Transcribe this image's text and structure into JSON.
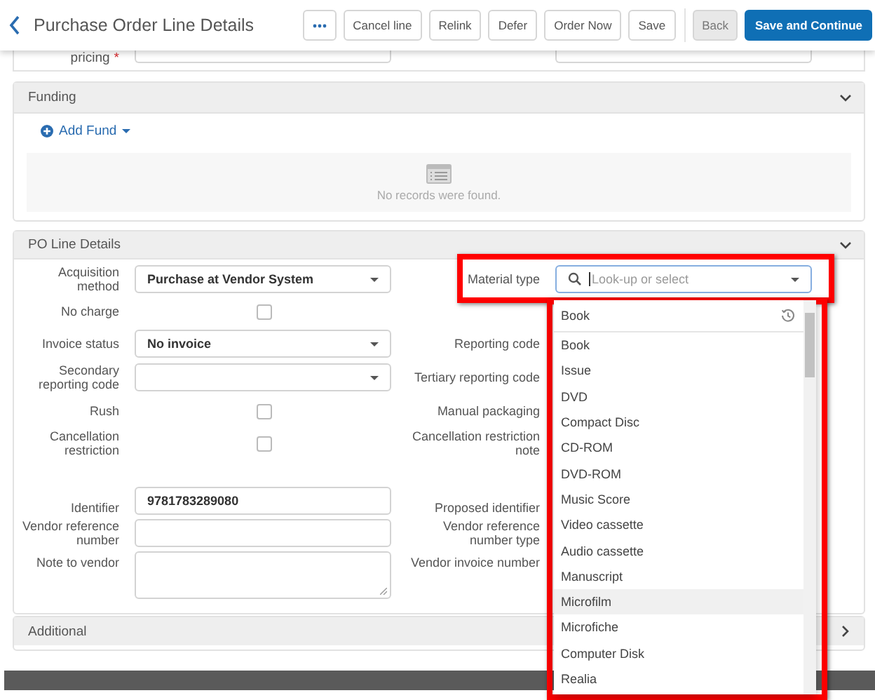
{
  "header": {
    "title": "Purchase Order Line Details",
    "buttons": [
      {
        "kind": "more"
      },
      {
        "kind": "default",
        "label": "Cancel line"
      },
      {
        "kind": "default",
        "label": "Relink"
      },
      {
        "kind": "default",
        "label": "Defer"
      },
      {
        "kind": "default",
        "label": "Order Now"
      },
      {
        "kind": "default",
        "label": "Save"
      },
      {
        "kind": "muted",
        "label": "Back"
      },
      {
        "kind": "primary",
        "label": "Save and Continue"
      }
    ]
  },
  "pricing_fragment": {
    "label": "pricing",
    "required_mark": "*"
  },
  "funding": {
    "title": "Funding",
    "add_fund": "Add Fund",
    "empty_text": "No records were found."
  },
  "po_line_details": {
    "title": "PO Line Details",
    "rows": [
      {
        "left": {
          "label": "Acquisition method",
          "kind": "select",
          "value": "Purchase at Vendor System"
        },
        "right": {
          "label": "Material type",
          "kind": "lookup",
          "placeholder": "Look-up or select"
        }
      },
      {
        "left": {
          "label": "No charge",
          "kind": "checkbox",
          "checked": false
        }
      },
      {
        "left": {
          "label": "Invoice status",
          "kind": "select",
          "value": "No invoice"
        },
        "right": {
          "label": "Reporting code"
        }
      },
      {
        "left": {
          "label": "Secondary reporting code",
          "kind": "select"
        },
        "right": {
          "label": "Tertiary reporting code"
        }
      },
      {
        "left": {
          "label": "Rush",
          "kind": "checkbox",
          "checked": false
        },
        "right": {
          "label": "Manual packaging"
        }
      },
      {
        "left": {
          "label": "Cancellation restriction",
          "kind": "checkbox",
          "checked": false
        },
        "right": {
          "label": "Cancellation restriction note"
        }
      },
      {
        "left": {
          "label": "Identifier",
          "kind": "input",
          "value": "9781783289080"
        },
        "right": {
          "label": "Proposed identifier"
        }
      },
      {
        "left": {
          "label": "Vendor reference number",
          "kind": "input"
        },
        "right": {
          "label": "Vendor reference number type"
        }
      },
      {
        "left": {
          "label": "Note to vendor",
          "kind": "textarea"
        },
        "right": {
          "label": "Vendor invoice number"
        }
      }
    ]
  },
  "additional": {
    "title": "Additional"
  },
  "material_dropdown": {
    "recent": "Book",
    "options": [
      {
        "label": "Book",
        "highlighted": false
      },
      {
        "label": "Issue",
        "highlighted": false
      },
      {
        "label": "DVD",
        "highlighted": false
      },
      {
        "label": "Compact Disc",
        "highlighted": false
      },
      {
        "label": "CD-ROM",
        "highlighted": false
      },
      {
        "label": "DVD-ROM",
        "highlighted": false
      },
      {
        "label": "Music Score",
        "highlighted": false
      },
      {
        "label": "Video cassette",
        "highlighted": false
      },
      {
        "label": "Audio cassette",
        "highlighted": false
      },
      {
        "label": "Manuscript",
        "highlighted": false
      },
      {
        "label": "Microfilm",
        "highlighted": true
      },
      {
        "label": "Microfiche",
        "highlighted": false
      },
      {
        "label": "Computer Disk",
        "highlighted": false
      },
      {
        "label": "Realia",
        "highlighted": false
      }
    ]
  }
}
